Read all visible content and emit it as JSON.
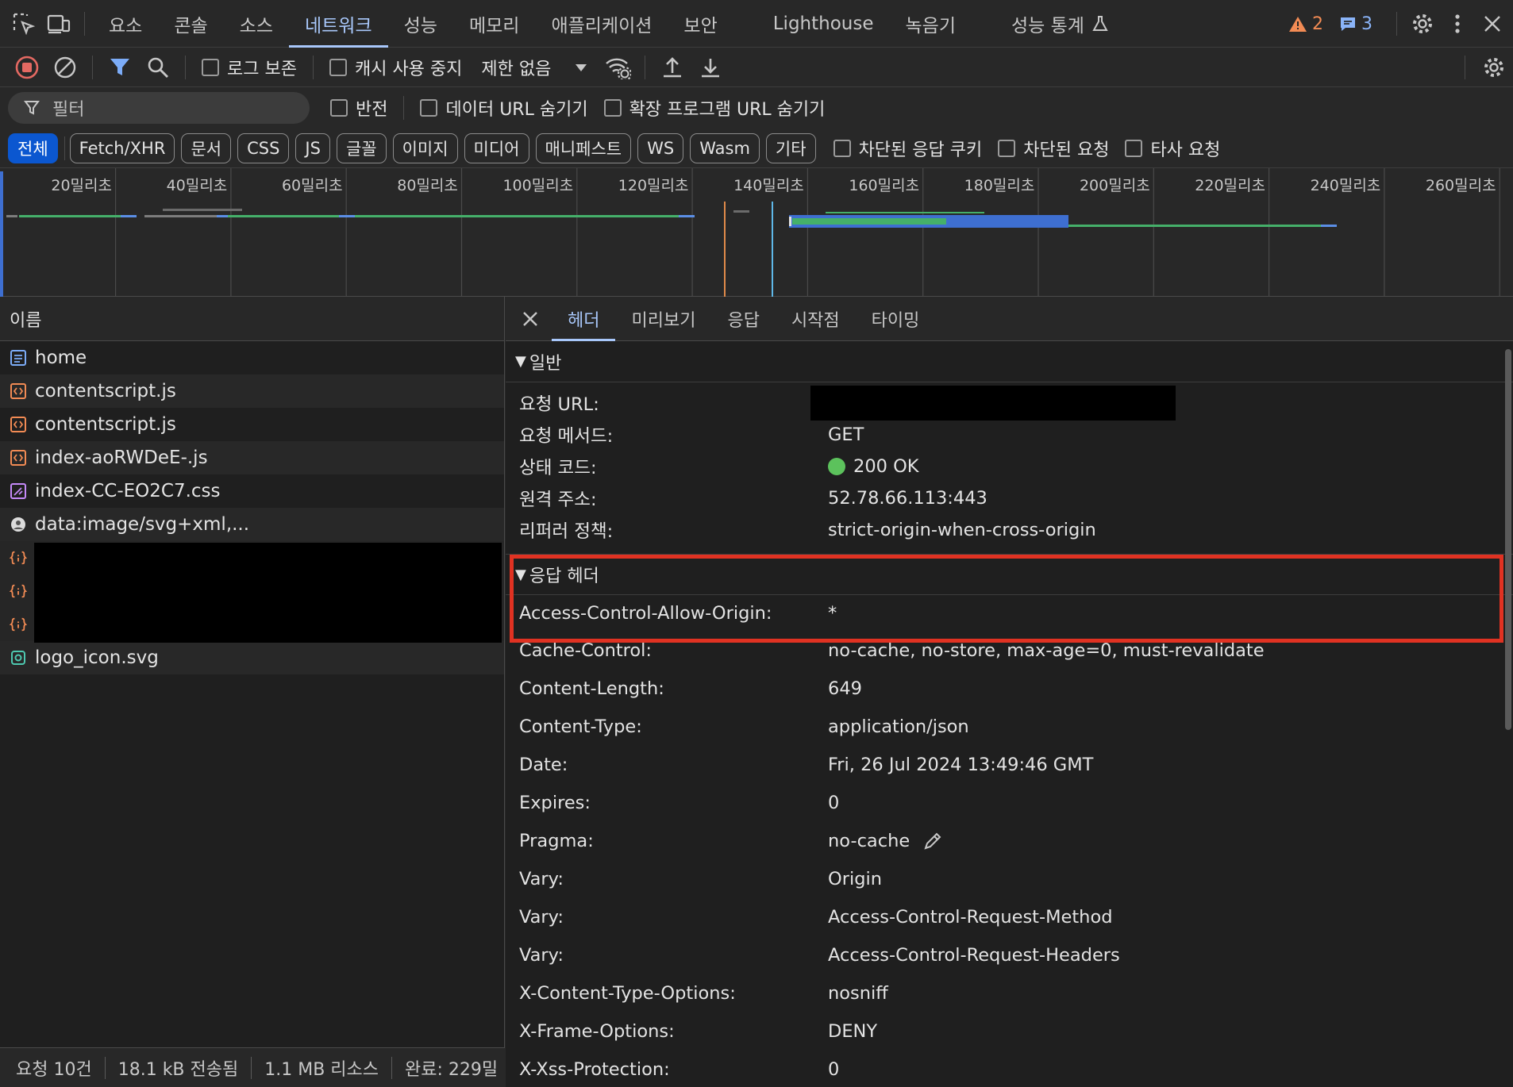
{
  "top_tabs": [
    "요소",
    "콘솔",
    "소스",
    "네트워크",
    "성능",
    "메모리",
    "애플리케이션",
    "보안",
    "Lighthouse",
    "녹음기",
    "성능 통계"
  ],
  "issues": {
    "warnings": "2",
    "messages": "3"
  },
  "toolbar": {
    "preserve_log": "로그 보존",
    "disable_cache": "캐시 사용 중지",
    "throttle": "제한 없음"
  },
  "filter": {
    "placeholder": "필터",
    "invert": "반전",
    "hide_data_urls": "데이터 URL 숨기기",
    "hide_extension_urls": "확장 프로그램 URL 숨기기"
  },
  "type_filters": [
    "전체",
    "Fetch/XHR",
    "문서",
    "CSS",
    "JS",
    "글꼴",
    "이미지",
    "미디어",
    "매니페스트",
    "WS",
    "Wasm",
    "기타"
  ],
  "extra_filters": [
    "차단된 응답 쿠키",
    "차단된 요청",
    "타사 요청"
  ],
  "timeline": {
    "ticks": [
      "20밀리초",
      "40밀리초",
      "60밀리초",
      "80밀리초",
      "100밀리초",
      "120밀리초",
      "140밀리초",
      "160밀리초",
      "180밀리초",
      "200밀리초",
      "220밀리초",
      "240밀리초",
      "260밀리초"
    ]
  },
  "request_list": {
    "header": "이름",
    "rows": [
      {
        "name": "home",
        "type": "document"
      },
      {
        "name": "contentscript.js",
        "type": "script"
      },
      {
        "name": "contentscript.js",
        "type": "script"
      },
      {
        "name": "index-aoRWDeE-.js",
        "type": "script"
      },
      {
        "name": "index-CC-EO2C7.css",
        "type": "stylesheet"
      },
      {
        "name": "data:image/svg+xml,...",
        "type": "image"
      },
      {
        "name": "",
        "type": "fetch"
      },
      {
        "name": "",
        "type": "fetch"
      },
      {
        "name": "",
        "type": "fetch"
      },
      {
        "name": "logo_icon.svg",
        "type": "svg"
      }
    ]
  },
  "statusbar": {
    "requests": "요청 10건",
    "transferred": "18.1 kB 전송됨",
    "resources": "1.1 MB 리소스",
    "finish": "완료: 229밀"
  },
  "detail_tabs": [
    "헤더",
    "미리보기",
    "응답",
    "시작점",
    "타이밍"
  ],
  "general": {
    "title": "일반",
    "fields": [
      {
        "key": "요청 URL:",
        "value": ""
      },
      {
        "key": "요청 메서드:",
        "value": "GET"
      },
      {
        "key": "상태 코드:",
        "value": "200 OK"
      },
      {
        "key": "원격 주소:",
        "value": "52.78.66.113:443"
      },
      {
        "key": "리퍼러 정책:",
        "value": "strict-origin-when-cross-origin"
      }
    ]
  },
  "response_headers": {
    "title": "응답 헤더",
    "fields": [
      {
        "key": "Access-Control-Allow-Origin:",
        "value": "*"
      },
      {
        "key": "Cache-Control:",
        "value": "no-cache, no-store, max-age=0, must-revalidate"
      },
      {
        "key": "Content-Length:",
        "value": "649"
      },
      {
        "key": "Content-Type:",
        "value": "application/json"
      },
      {
        "key": "Date:",
        "value": "Fri, 26 Jul 2024 13:49:46 GMT"
      },
      {
        "key": "Expires:",
        "value": "0"
      },
      {
        "key": "Pragma:",
        "value": "no-cache"
      },
      {
        "key": "Vary:",
        "value": "Origin"
      },
      {
        "key": "Vary:",
        "value": "Access-Control-Request-Method"
      },
      {
        "key": "Vary:",
        "value": "Access-Control-Request-Headers"
      },
      {
        "key": "X-Content-Type-Options:",
        "value": "nosniff"
      },
      {
        "key": "X-Frame-Options:",
        "value": "DENY"
      },
      {
        "key": "X-Xss-Protection:",
        "value": "0"
      }
    ]
  },
  "colors": {
    "accent": "#a8c7fa",
    "highlight": "#e03222",
    "status_ok": "#5cc25c",
    "warning": "#f28b54"
  }
}
